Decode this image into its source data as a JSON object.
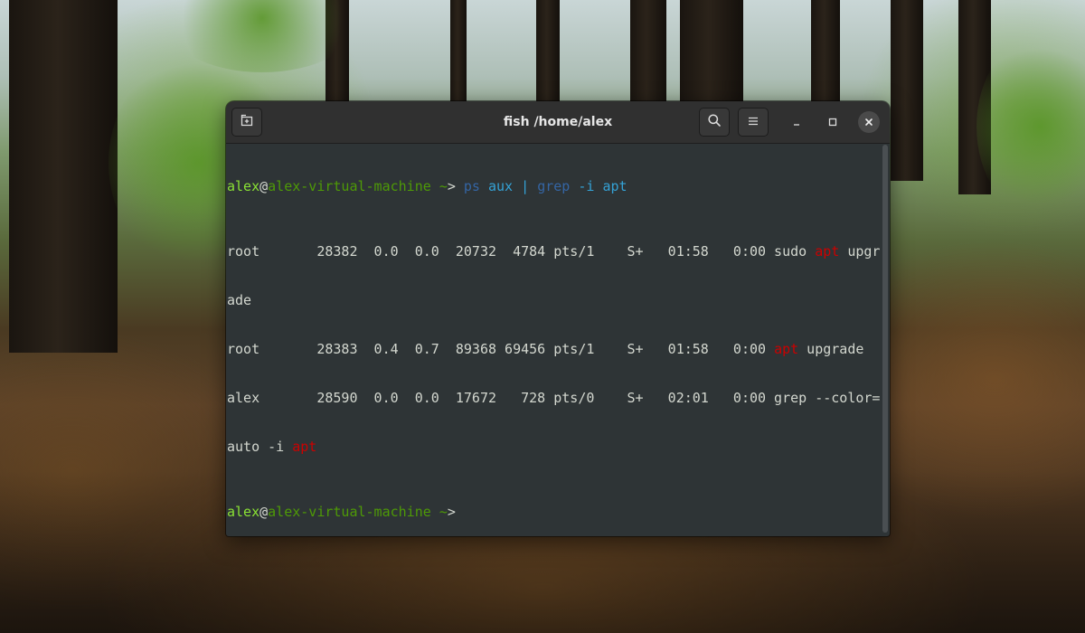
{
  "window": {
    "title": "fish /home/alex"
  },
  "icons": {
    "new_tab": "new-tab-icon",
    "search": "search-icon",
    "menu": "hamburger-menu-icon",
    "minimize": "minimize-icon",
    "maximize": "maximize-icon",
    "close": "close-icon"
  },
  "terminal": {
    "user": "alex",
    "at": "@",
    "host": "alex-virtual-machine",
    "cwd": "~",
    "prompt_char": ">",
    "command": {
      "ps": "ps",
      "aux": "aux",
      "pipe": "|",
      "grep": "grep",
      "flag": "-i",
      "pattern": "apt"
    },
    "rows": [
      {
        "pre": "root       28382  0.0  0.0  20732  4784 pts/1    S+   01:58   0:00 sudo ",
        "match": "apt",
        "post": " upgr"
      },
      {
        "pre": "ade",
        "match": "",
        "post": ""
      },
      {
        "pre": "root       28383  0.4  0.7  89368 69456 pts/1    S+   01:58   0:00 ",
        "match": "apt",
        "post": " upgrade"
      },
      {
        "pre": "alex       28590  0.0  0.0  17672   728 pts/0    S+   02:01   0:00 grep --color=",
        "match": "",
        "post": ""
      },
      {
        "pre": "auto -i ",
        "match": "apt",
        "post": ""
      }
    ]
  },
  "colors": {
    "terminal_bg": "#2e3436",
    "user": "#8ae234",
    "host": "#4e9a06",
    "command": "#3465a4",
    "argument": "#34a2d6",
    "match": "#cc0000"
  }
}
